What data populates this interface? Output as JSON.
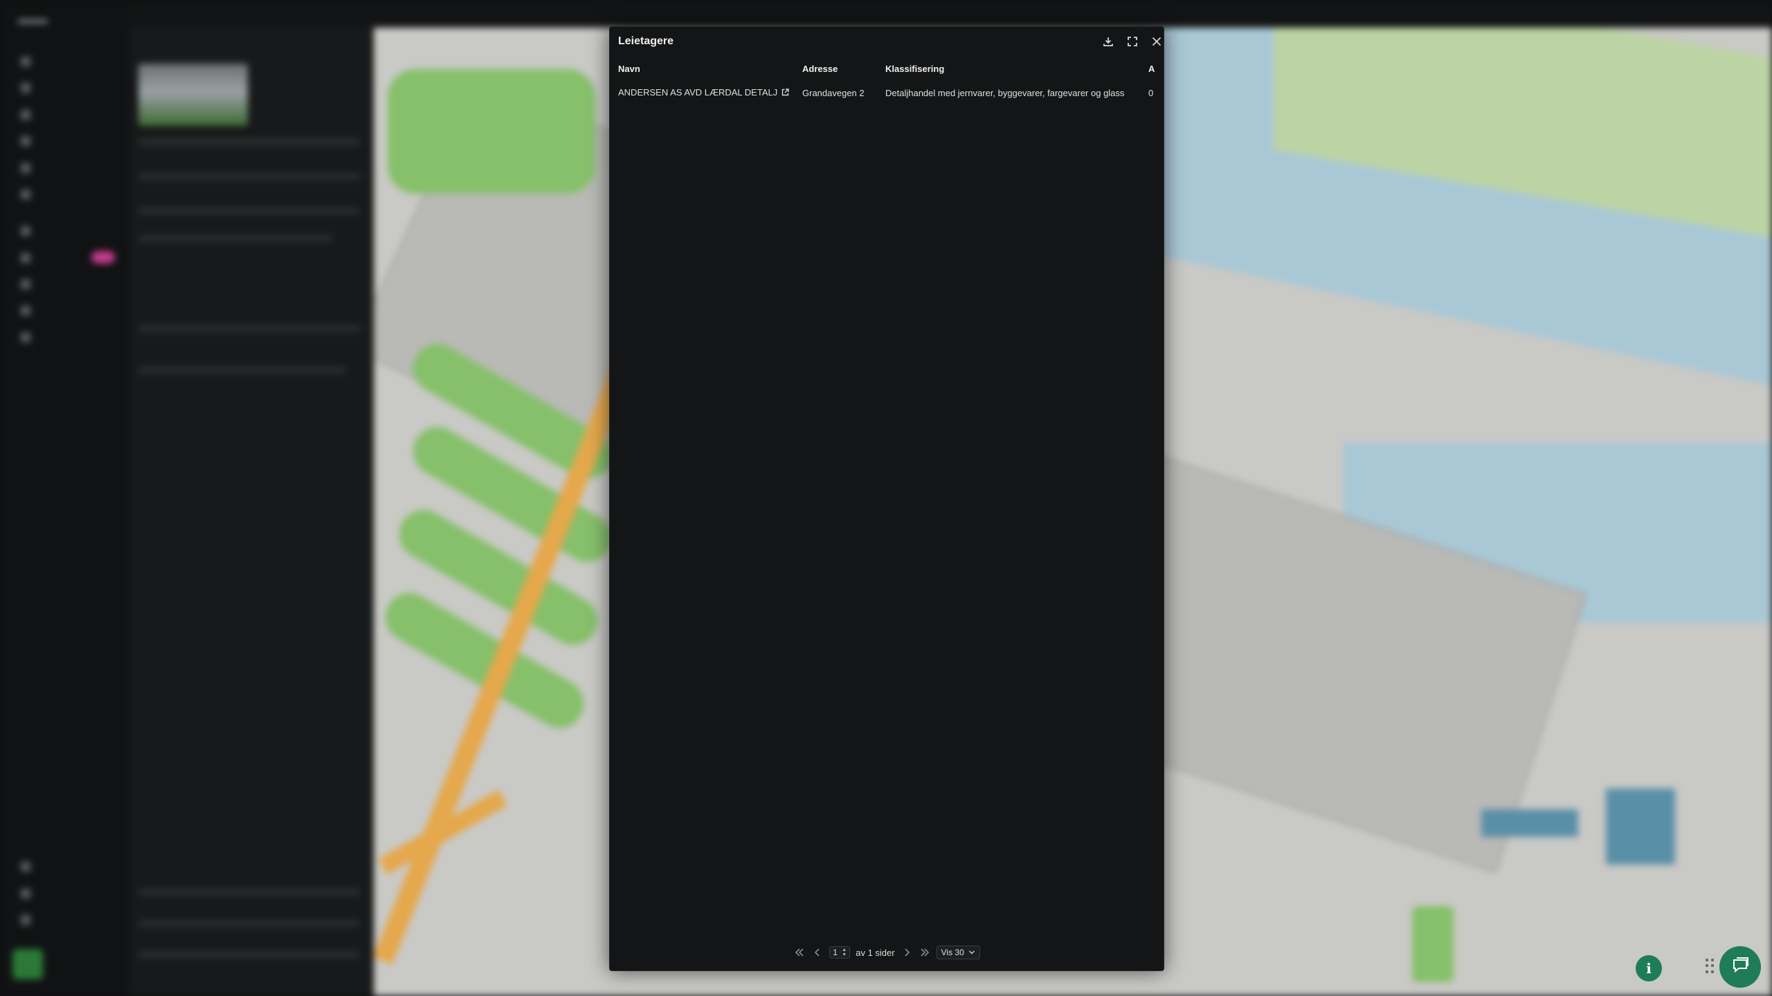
{
  "modal": {
    "title": "Leietagere",
    "download_icon": "download-icon",
    "expand_icon": "expand-icon",
    "close_icon": "close-icon"
  },
  "table": {
    "columns": [
      "Navn",
      "Adresse",
      "Klassifisering",
      "Ans"
    ],
    "rows": [
      {
        "name": "ANDERSEN AS AVD LÆRDAL DETALJ",
        "address": "Grandavegen 2",
        "classification": "Detaljhandel med jernvarer, byggevarer, fargevarer og glass",
        "employees": "0"
      }
    ]
  },
  "pager": {
    "current_page": "1",
    "of_pages": "av 1 sider",
    "per_page": "Vis 30"
  },
  "floating": {
    "info_label": "i"
  }
}
